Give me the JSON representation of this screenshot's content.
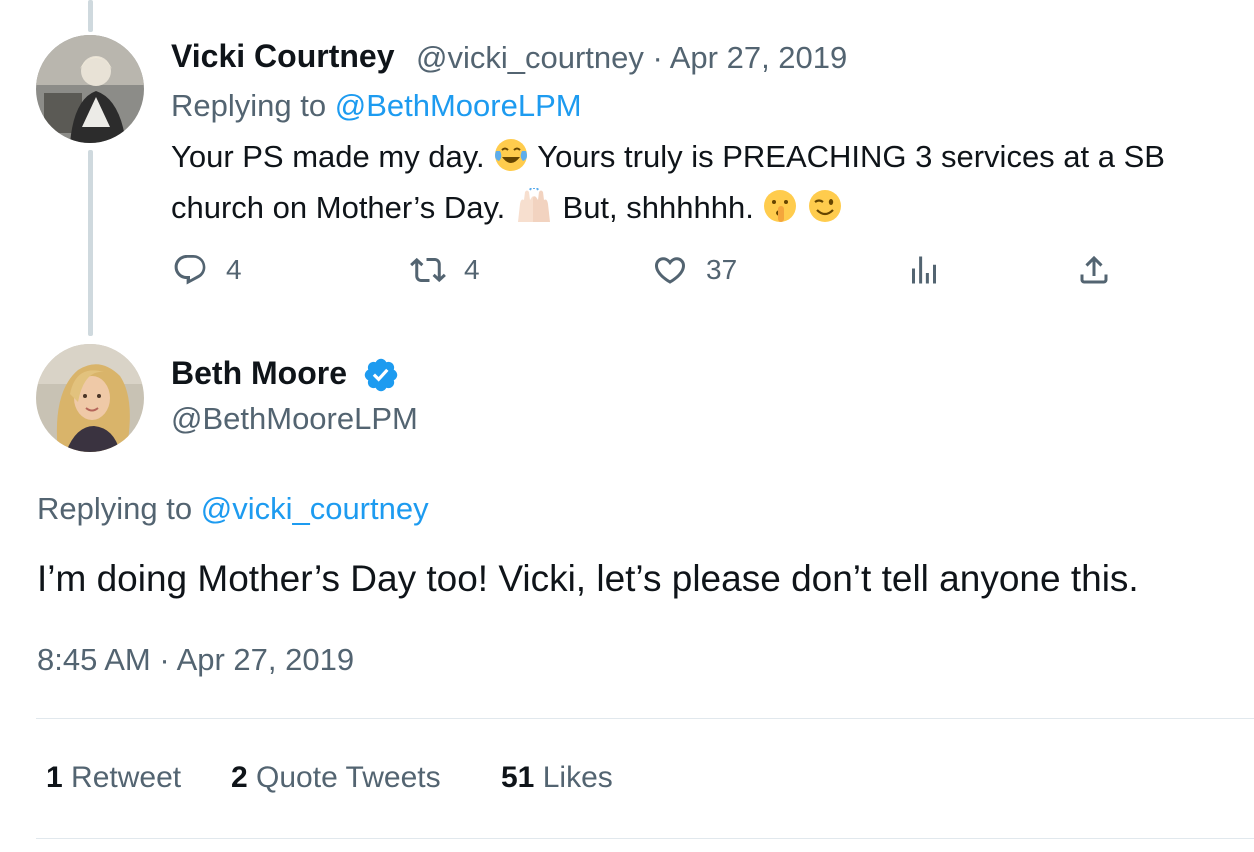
{
  "parent_tweet": {
    "author_name": "Vicki Courtney",
    "handle": "@vicki_courtney",
    "separator": "·",
    "date": "Apr 27, 2019",
    "replying_prefix": "Replying to ",
    "replying_to": "@BethMooreLPM",
    "text_line1_a": "Your PS made my day.",
    "text_line1_b": "Yours truly is PREACHING 3 services at a SB",
    "text_line2_a": "church on Mother’s Day.",
    "text_line2_b": "But, shhhhhh.",
    "emojis": [
      "laughing-crying",
      "raised-hands",
      "shushing-face",
      "winking-face"
    ],
    "actions": {
      "reply_count": "4",
      "retweet_count": "4",
      "like_count": "37"
    }
  },
  "main_tweet": {
    "author_name": "Beth Moore",
    "verified": true,
    "handle": "@BethMooreLPM",
    "replying_prefix": "Replying to ",
    "replying_to": "@vicki_courtney",
    "text": "I’m doing Mother’s Day too! Vicki, let’s please don’t tell anyone this.",
    "timestamp": "8:45 AM · Apr 27, 2019",
    "stats": {
      "retweets_count": "1",
      "retweets_label": "Retweet",
      "quotes_count": "2",
      "quotes_label": "Quote Tweets",
      "likes_count": "51",
      "likes_label": "Likes"
    }
  },
  "colors": {
    "link": "#1d9bf0",
    "muted": "#536471",
    "text": "#0f1419",
    "thread_line": "#cfd9de",
    "verified": "#1d9bf0"
  }
}
